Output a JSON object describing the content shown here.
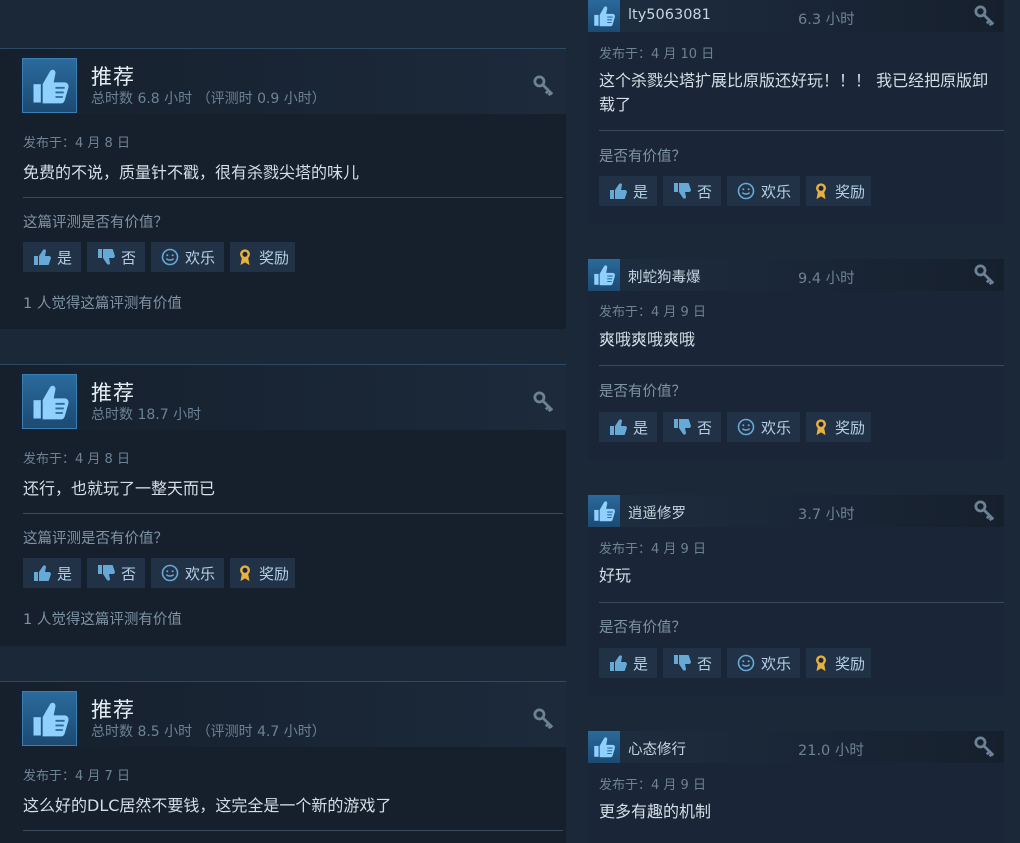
{
  "left_reviews": [
    {
      "title": "推荐",
      "hours": "总时数 6.8 小时 （评测时 0.9 小时）",
      "posted": "发布于：4 月 8 日",
      "body": "免费的不说，质量针不戳，很有杀戮尖塔的味儿",
      "question": "这篇评测是否有价值？",
      "found_helpful": "1 人觉得这篇评测有价值"
    },
    {
      "title": "推荐",
      "hours": "总时数 18.7 小时",
      "posted": "发布于：4 月 8 日",
      "body": "还行，也就玩了一整天而已",
      "question": "这篇评测是否有价值？",
      "found_helpful": "1 人觉得这篇评测有价值"
    },
    {
      "title": "推荐",
      "hours": "总时数 8.5 小时 （评测时 4.7 小时）",
      "posted": "发布于：4 月 7 日",
      "body": "这么好的DLC居然不要钱，这完全是一个新的游戏了"
    }
  ],
  "right_reviews": [
    {
      "user": "lty5063081",
      "hours": "6.3 小时",
      "posted": "发布于：4 月 10 日",
      "body": "这个杀戮尖塔扩展比原版还好玩！！！ 我已经把原版卸载了",
      "question": "是否有价值？"
    },
    {
      "user": "刺蛇狗毒爆",
      "hours": "9.4 小时",
      "posted": "发布于：4 月 9 日",
      "body": "爽哦爽哦爽哦",
      "question": "是否有价值？"
    },
    {
      "user": "逍遥修罗",
      "hours": "3.7 小时",
      "posted": "发布于：4 月 9 日",
      "body": "好玩",
      "question": "是否有价值？"
    },
    {
      "user": "心态修行",
      "hours": "21.0 小时",
      "posted": "发布于：4 月 9 日",
      "body": "更多有趣的机制"
    }
  ],
  "buttons": {
    "yes": "是",
    "no": "否",
    "funny": "欢乐",
    "award": "奖励"
  },
  "icons": {
    "thumb": "thumbs-up-icon",
    "key": "key-icon",
    "yes": "thumbs-up-icon",
    "no": "thumbs-down-icon",
    "funny": "smiley-icon",
    "award": "award-icon"
  },
  "colors": {
    "background": "#1b2838",
    "card": "#16202d",
    "accent_blue": "#66c0f4",
    "award_gold": "#e8b040"
  }
}
